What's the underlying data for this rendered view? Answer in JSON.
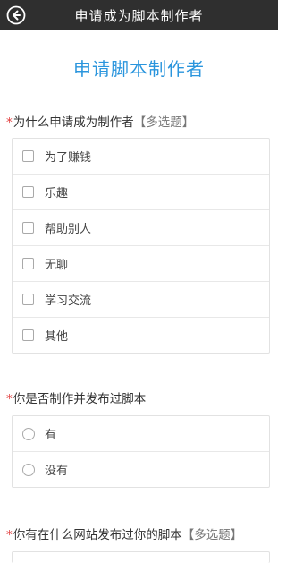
{
  "header": {
    "title": "申请成为脚本制作者",
    "back_icon": "back-arrow-icon"
  },
  "form": {
    "title": "申请脚本制作者",
    "questions": [
      {
        "required_mark": "*",
        "text": "为什么申请成为制作者",
        "tag": "【多选题】",
        "type": "checkbox",
        "options": [
          "为了赚钱",
          "乐趣",
          "帮助别人",
          "无聊",
          "学习交流",
          "其他"
        ]
      },
      {
        "required_mark": "*",
        "text": "你是否制作并发布过脚本",
        "tag": "",
        "type": "radio",
        "options": [
          "有",
          "没有"
        ]
      },
      {
        "required_mark": "*",
        "text": "你有在什么网站发布过你的脚本",
        "tag": "【多选题】",
        "type": "checkbox",
        "options": []
      }
    ]
  },
  "colors": {
    "topbar": "#2f2f2f",
    "accent": "#2a95dd",
    "required": "#e23b3b"
  }
}
